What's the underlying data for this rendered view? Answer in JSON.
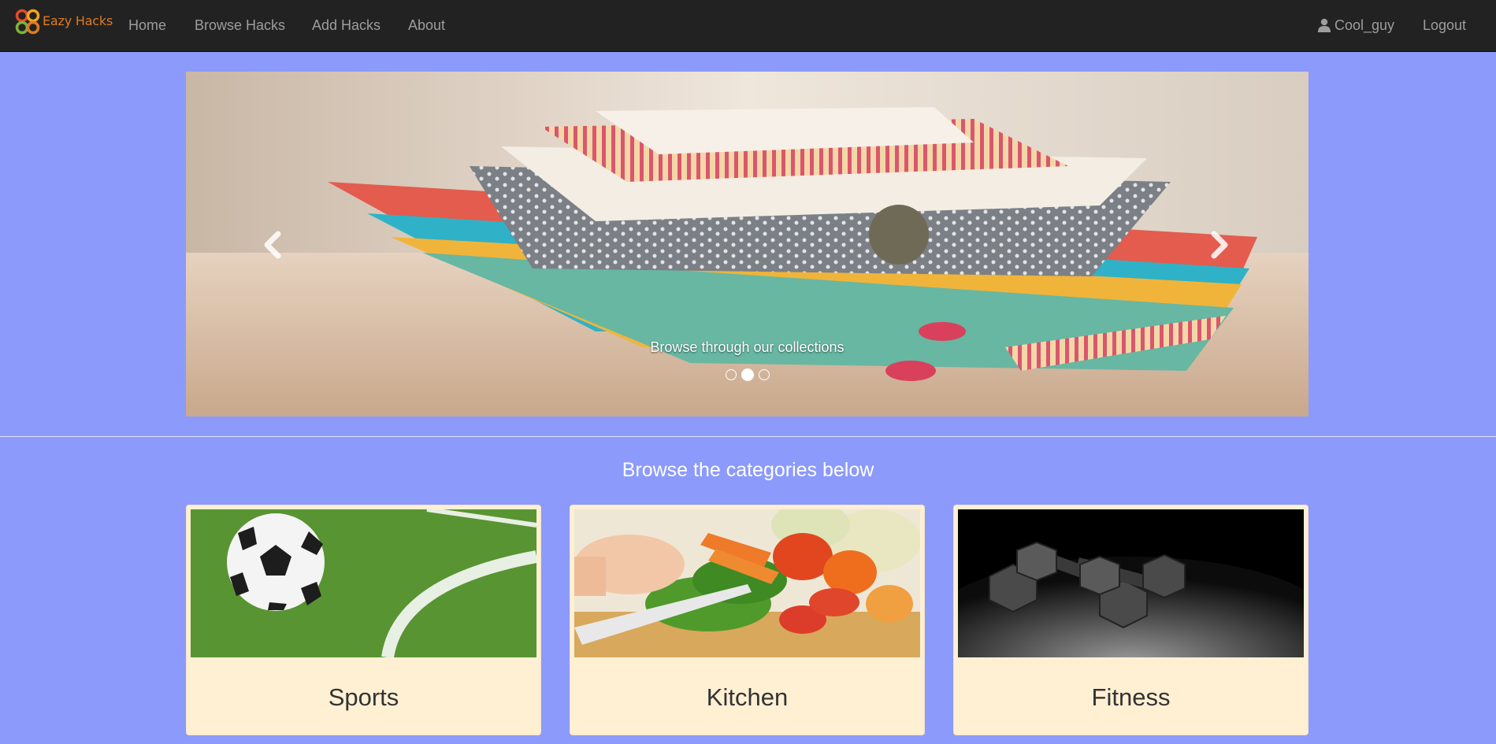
{
  "navbar": {
    "brand": "Eazy Hacks",
    "links": {
      "home": "Home",
      "browse": "Browse Hacks",
      "add": "Add Hacks",
      "about": "About"
    },
    "user": "Cool_guy",
    "logout": "Logout"
  },
  "carousel": {
    "caption": "Browse through our collections",
    "indicator_count": 3,
    "active_indicator": 2,
    "controls": [
      "chevron-left-icon",
      "chevron-right-icon"
    ]
  },
  "categories": {
    "heading": "Browse the categories below",
    "items": [
      {
        "label": "Sports",
        "image": "soccer-ball-on-grass"
      },
      {
        "label": "Kitchen",
        "image": "chopping-vegetables"
      },
      {
        "label": "Fitness",
        "image": "dumbbells"
      }
    ]
  },
  "colors": {
    "page_background": "#8c9afc",
    "navbar_background": "#222222",
    "nav_link": "#9d9d9d",
    "brand": "#e07a22",
    "card_background": "#fff0d4",
    "card_text": "#333333"
  }
}
